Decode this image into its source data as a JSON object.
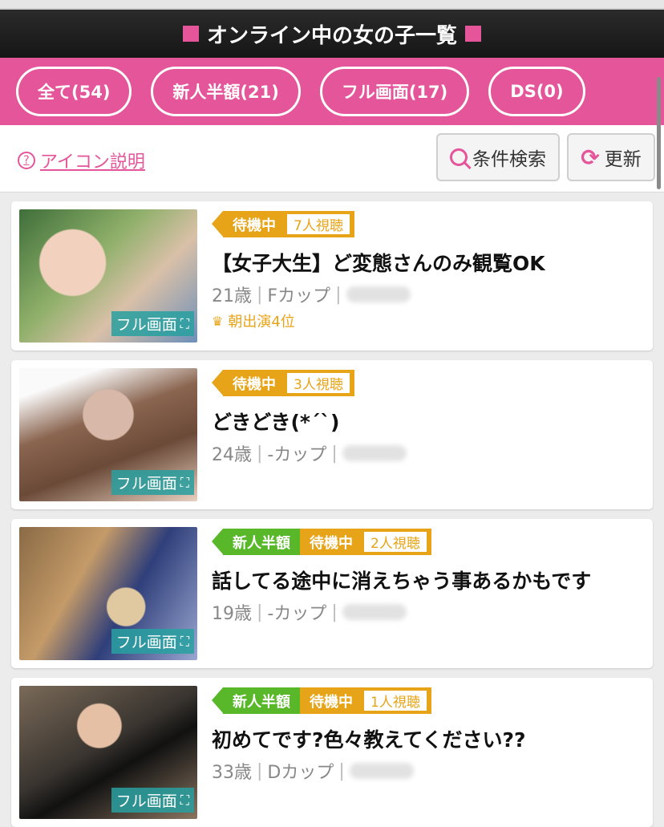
{
  "header": {
    "title": "オンライン中の女の子一覧"
  },
  "filters": [
    {
      "label": "全て(54)"
    },
    {
      "label": "新人半額(21)"
    },
    {
      "label": "フル画面(17)"
    },
    {
      "label": "DS(0)"
    }
  ],
  "toolbar": {
    "help_label": "アイコン説明",
    "help_icon": "?",
    "search_label": "条件検索",
    "refresh_label": "更新"
  },
  "colors": {
    "brand_pink": "#e4559a",
    "status_orange": "#e8a418",
    "new_green": "#58b82a",
    "full_teal": "#28a0a0"
  },
  "cards": [
    {
      "is_new": false,
      "new_label": "",
      "status": "待機中",
      "viewers": "7人視聴",
      "title": "【女子大生】ど変態さんのみ観覧OK",
      "age": "21歳",
      "cup": "Fカップ",
      "rank": "朝出演4位",
      "full_label": "フル画面"
    },
    {
      "is_new": false,
      "new_label": "",
      "status": "待機中",
      "viewers": "3人視聴",
      "title": "どきどき(*´`)",
      "age": "24歳",
      "cup": "-カップ",
      "rank": "",
      "full_label": "フル画面"
    },
    {
      "is_new": true,
      "new_label": "新人半額",
      "status": "待機中",
      "viewers": "2人視聴",
      "title": "話してる途中に消えちゃう事あるかもです",
      "age": "19歳",
      "cup": "-カップ",
      "rank": "",
      "full_label": "フル画面"
    },
    {
      "is_new": true,
      "new_label": "新人半額",
      "status": "待機中",
      "viewers": "1人視聴",
      "title": "初めてです?色々教えてください??",
      "age": "33歳",
      "cup": "Dカップ",
      "rank": "",
      "full_label": "フル画面"
    }
  ]
}
